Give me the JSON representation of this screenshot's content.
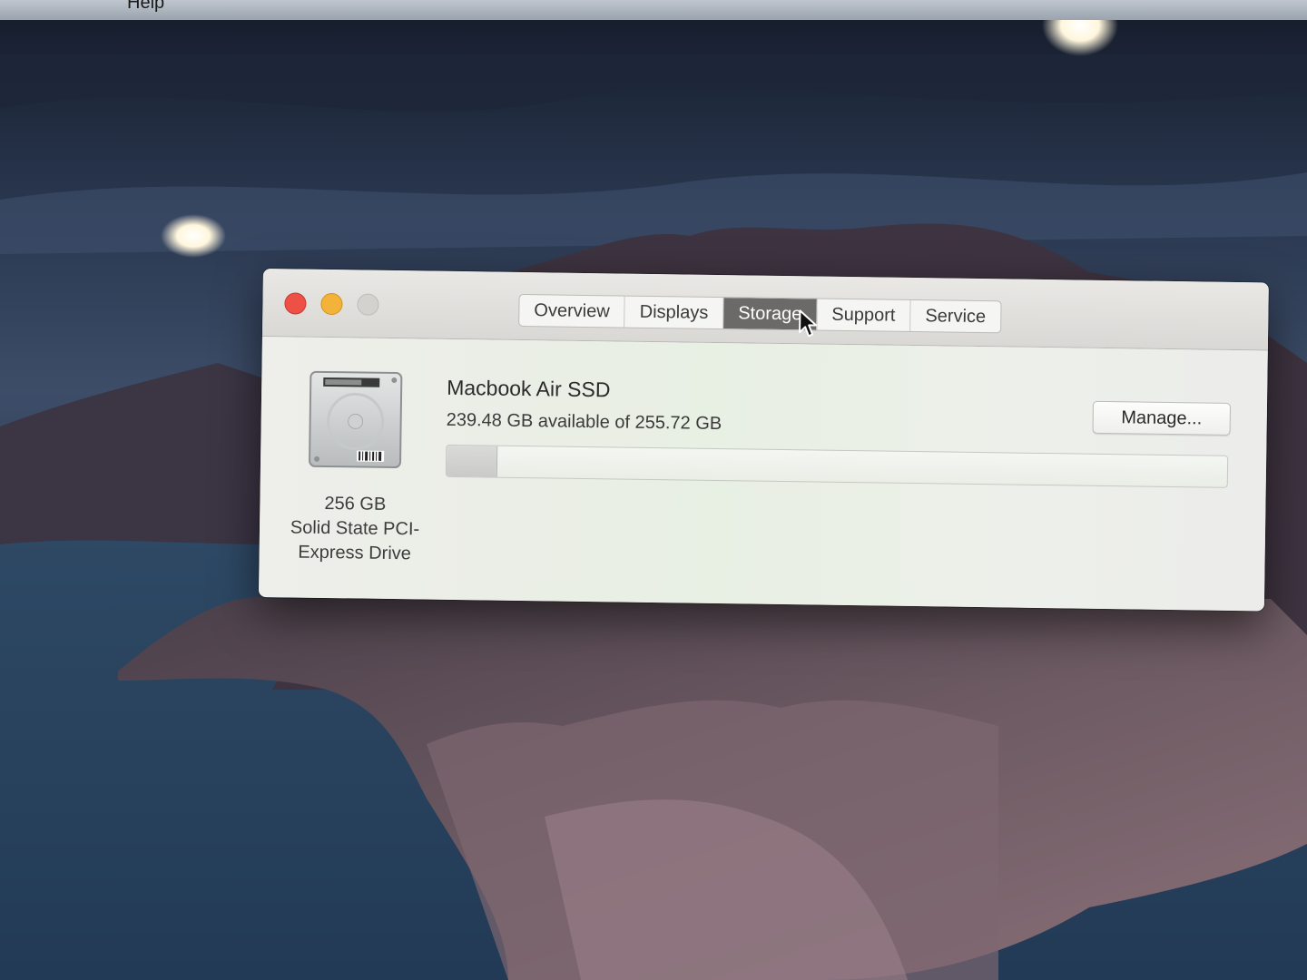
{
  "menubar": {
    "partial_item": "Help"
  },
  "window": {
    "tabs": [
      {
        "label": "Overview",
        "active": false
      },
      {
        "label": "Displays",
        "active": false
      },
      {
        "label": "Storage",
        "active": true
      },
      {
        "label": "Support",
        "active": false
      },
      {
        "label": "Service",
        "active": false
      }
    ]
  },
  "storage": {
    "drive": {
      "capacity_label": "256 GB",
      "type_line1": "Solid State PCI-",
      "type_line2": "Express Drive",
      "icon": "internal-drive-icon"
    },
    "volume": {
      "name": "Macbook Air SSD",
      "availability": "239.48 GB available of 255.72 GB",
      "used_fraction": 0.0635
    },
    "manage_label": "Manage..."
  },
  "colors": {
    "close": "#ee4f47",
    "minimize": "#f3b33a",
    "zoom_disabled": "#d3d2cf",
    "active_tab": "#6b6a68"
  }
}
